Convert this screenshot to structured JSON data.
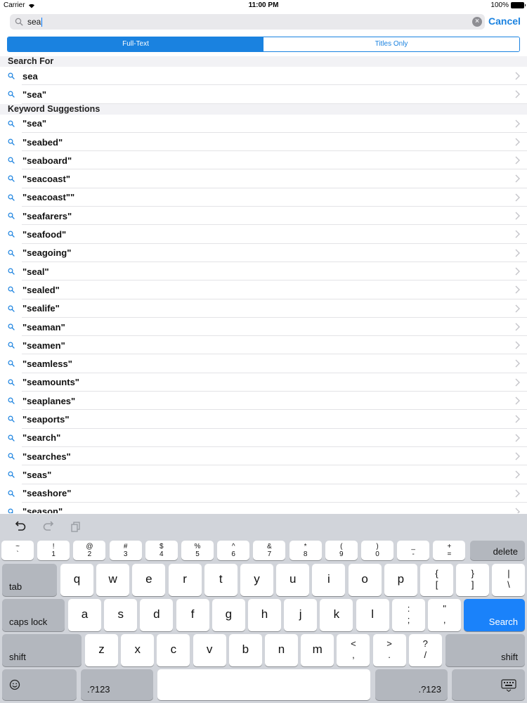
{
  "status_bar": {
    "carrier": "Carrier",
    "time": "11:00 PM",
    "battery": "100%"
  },
  "search": {
    "query": "sea",
    "cancel_label": "Cancel"
  },
  "segmented": {
    "items": [
      "Full-Text",
      "Titles Only"
    ],
    "selected_index": 0
  },
  "sections": {
    "search_for": {
      "title": "Search For",
      "items": [
        "sea",
        "\"sea\""
      ]
    },
    "suggestions": {
      "title": "Keyword Suggestions",
      "items": [
        "\"sea\"",
        "\"seabed\"",
        "\"seaboard\"",
        "\"seacoast\"",
        "\"seacoast\"\"",
        "\"seafarers\"",
        "\"seafood\"",
        "\"seagoing\"",
        "\"seal\"",
        "\"sealed\"",
        "\"sealife\"",
        "\"seaman\"",
        "\"seamen\"",
        "\"seamless\"",
        "\"seamounts\"",
        "\"seaplanes\"",
        "\"seaports\"",
        "\"search\"",
        "\"searches\"",
        "\"seas\"",
        "\"seashore\"",
        "\"season\""
      ]
    }
  },
  "keyboard": {
    "shortcuts": [
      "undo-icon",
      "redo-icon",
      "paste-icon"
    ],
    "number_row": [
      {
        "top": "~",
        "bot": "`"
      },
      {
        "top": "!",
        "bot": "1"
      },
      {
        "top": "@",
        "bot": "2"
      },
      {
        "top": "#",
        "bot": "3"
      },
      {
        "top": "$",
        "bot": "4"
      },
      {
        "top": "%",
        "bot": "5"
      },
      {
        "top": "^",
        "bot": "6"
      },
      {
        "top": "&",
        "bot": "7"
      },
      {
        "top": "*",
        "bot": "8"
      },
      {
        "top": "(",
        "bot": "9"
      },
      {
        "top": ")",
        "bot": "0"
      },
      {
        "top": "_",
        "bot": "-"
      },
      {
        "top": "+",
        "bot": "="
      }
    ],
    "delete_label": "delete",
    "tab_label": "tab",
    "row1": [
      "q",
      "w",
      "e",
      "r",
      "t",
      "y",
      "u",
      "i",
      "o",
      "p"
    ],
    "row1_sym": [
      {
        "top": "{",
        "bot": "["
      },
      {
        "top": "}",
        "bot": "]"
      },
      {
        "top": "|",
        "bot": "\\"
      }
    ],
    "caps_label": "caps lock",
    "row2": [
      "a",
      "s",
      "d",
      "f",
      "g",
      "h",
      "j",
      "k",
      "l"
    ],
    "row2_sym": [
      {
        "top": ":",
        "bot": ";"
      },
      {
        "top": "\"",
        "bot": ","
      }
    ],
    "search_label": "Search",
    "shift_label": "shift",
    "row3": [
      "z",
      "x",
      "c",
      "v",
      "b",
      "n",
      "m"
    ],
    "row3_sym": [
      {
        "top": "<",
        "bot": ","
      },
      {
        "top": ">",
        "bot": "."
      },
      {
        "top": "?",
        "bot": "/"
      }
    ],
    "numbers_label": ".?123"
  }
}
